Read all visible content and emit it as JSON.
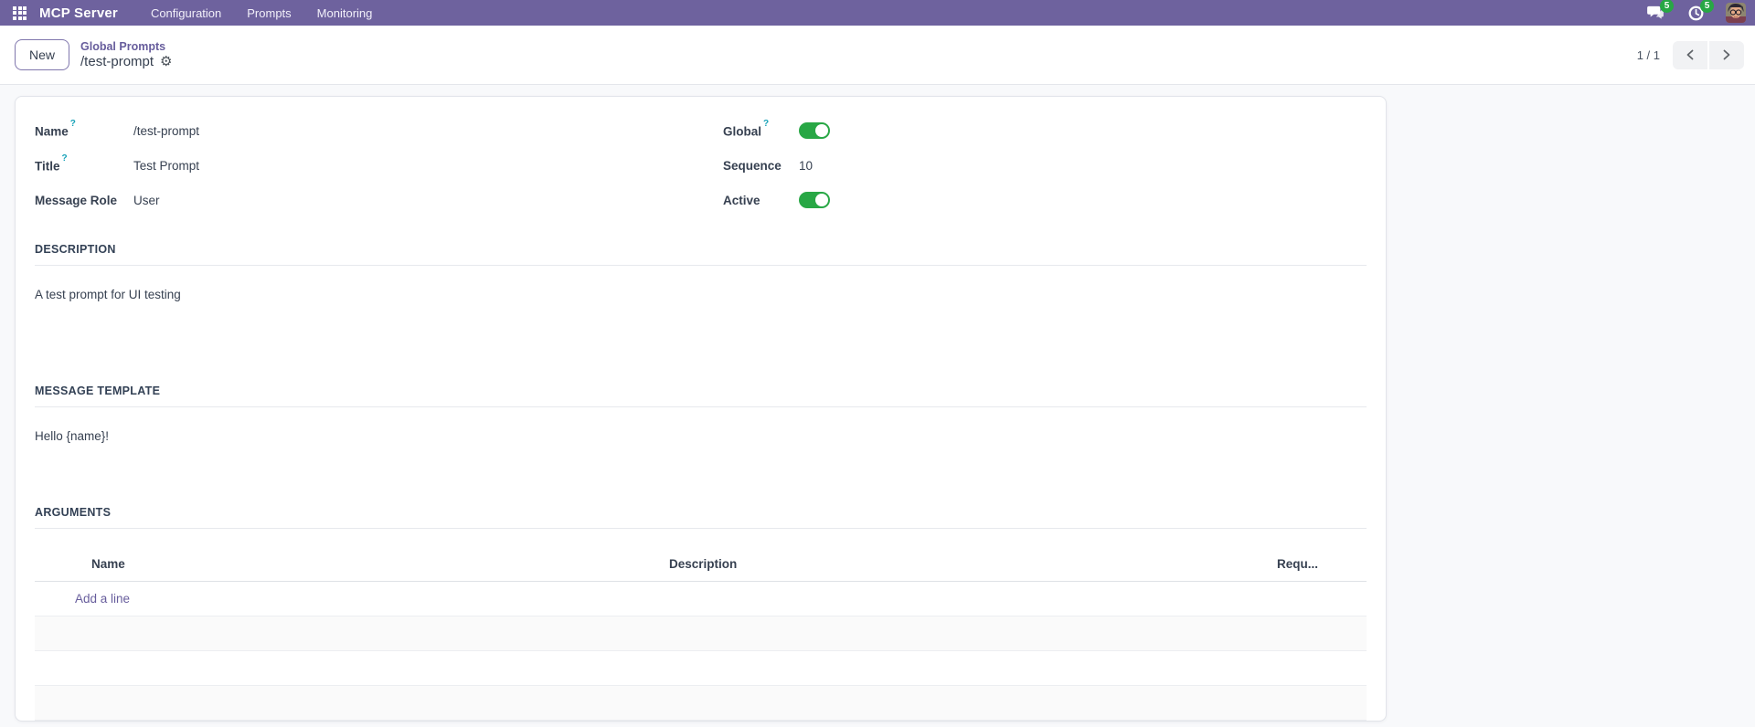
{
  "navbar": {
    "brand": "MCP Server",
    "menus": [
      {
        "label": "Configuration"
      },
      {
        "label": "Prompts"
      },
      {
        "label": "Monitoring"
      }
    ],
    "messages_badge": "5",
    "activities_badge": "5"
  },
  "control_panel": {
    "new_button": "New",
    "breadcrumb_parent": "Global Prompts",
    "breadcrumb_current": "/test-prompt",
    "pager": "1 / 1"
  },
  "form": {
    "fields": {
      "name": {
        "label": "Name",
        "help": "?",
        "value": "/test-prompt"
      },
      "title": {
        "label": "Title",
        "help": "?",
        "value": "Test Prompt"
      },
      "message_role": {
        "label": "Message Role",
        "value": "User"
      },
      "global": {
        "label": "Global",
        "help": "?",
        "on": true
      },
      "sequence": {
        "label": "Sequence",
        "value": "10"
      },
      "active": {
        "label": "Active",
        "on": true
      }
    },
    "sections": {
      "description": {
        "title": "DESCRIPTION",
        "value": "A test prompt for UI testing"
      },
      "message_template": {
        "title": "MESSAGE TEMPLATE",
        "value": "Hello {name}!"
      },
      "arguments": {
        "title": "ARGUMENTS",
        "columns": [
          {
            "label": "Name"
          },
          {
            "label": "Description"
          },
          {
            "label": "Requ..."
          }
        ],
        "add_line": "Add a line"
      }
    }
  },
  "colors": {
    "navbar": "#6e629e",
    "accent_link": "#675d9c",
    "toggle_on": "#28a745",
    "badge": "#28a745",
    "help": "#17a2b8",
    "page_background": "#f8f9fb"
  }
}
